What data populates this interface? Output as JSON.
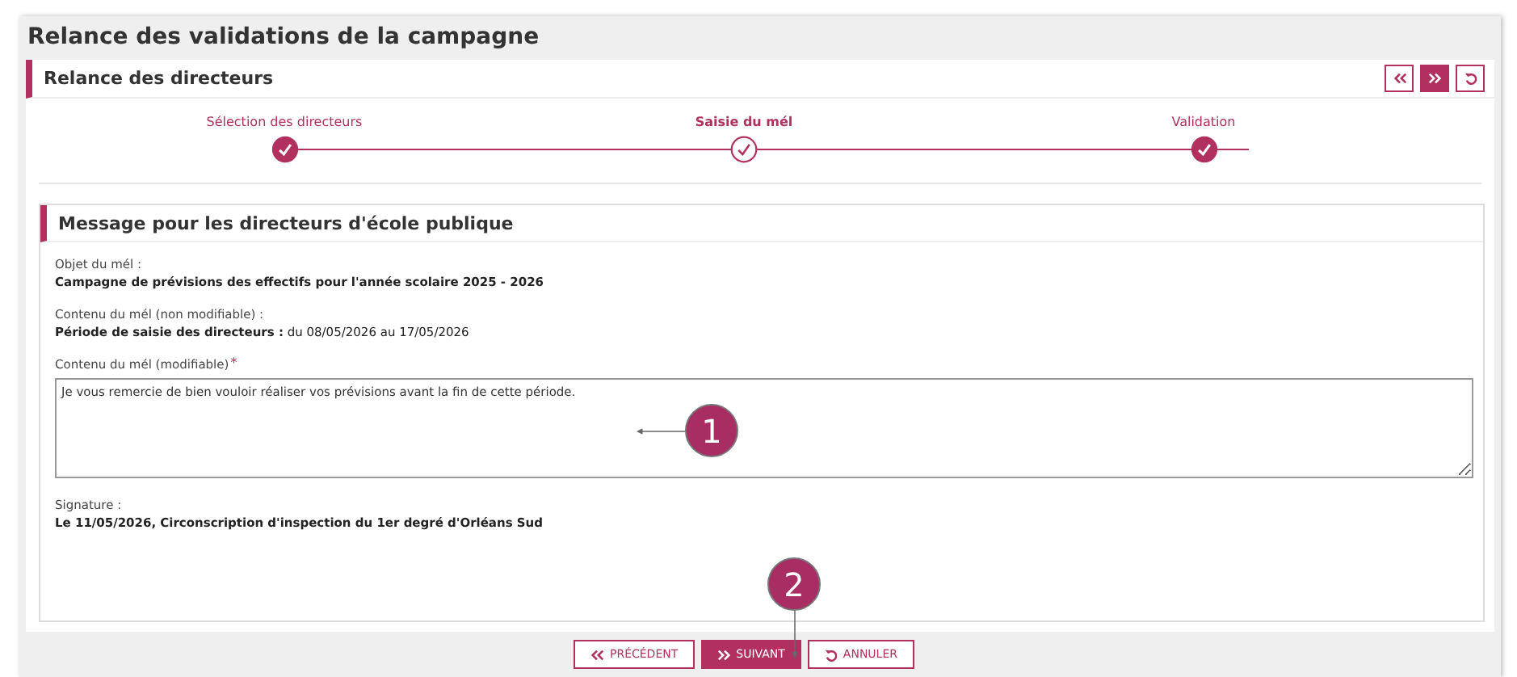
{
  "page_title": "Relance des validations de la campagne",
  "section": {
    "title": "Relance des directeurs",
    "toolbar": [
      {
        "kind": "previous",
        "selected": false
      },
      {
        "kind": "next",
        "selected": true
      },
      {
        "kind": "reset",
        "selected": false
      }
    ]
  },
  "steps": [
    {
      "label": "Sélection des directeurs",
      "selected": false
    },
    {
      "label": "Saisie du mél",
      "selected": true
    },
    {
      "label": "Validation",
      "selected": false
    }
  ],
  "message_panel": {
    "title": "Message pour les directeurs d'école publique",
    "subject_label": "Objet du mél :",
    "subject_value": "Campagne de prévisions des effectifs pour l'année scolaire 2025 - 2026",
    "fixed_label": "Contenu du mél (non modifiable) :",
    "fixed_value": "**Période de saisie des directeurs :** du 08/05/2026 au 17/05/2026",
    "editable_label": "Contenu du mél (modifiable)",
    "required_mark": "*",
    "editable_value": "Je vous remercie de bien vouloir réaliser vos prévisions avant la fin de cette période.",
    "signature_label": "Signature :",
    "signature_value": "Le 11/05/2026, Circonscription d'inspection du 1er degré d'Orléans Sud"
  },
  "annotations": [
    "1",
    "2"
  ],
  "buttons": [
    {
      "kind": "previous",
      "label": "PRÉCÉDENT",
      "selected": false
    },
    {
      "kind": "next",
      "label": "SUIVANT",
      "selected": true
    },
    {
      "kind": "reset",
      "label": "ANNULER",
      "selected": false
    }
  ]
}
